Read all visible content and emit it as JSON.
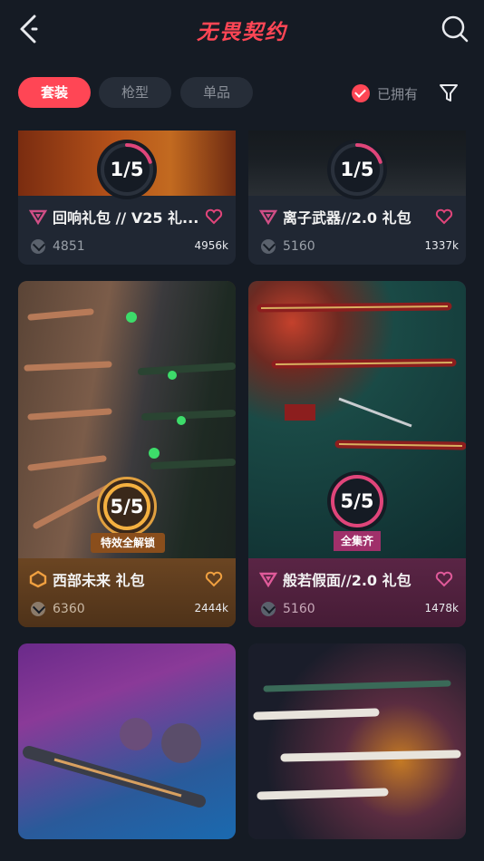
{
  "header": {
    "title": "无畏契约"
  },
  "tabs": [
    {
      "label": "套装",
      "active": true
    },
    {
      "label": "枪型",
      "active": false
    },
    {
      "label": "单品",
      "active": false
    }
  ],
  "owned_filter": {
    "label": "已拥有",
    "checked": true
  },
  "colors": {
    "accent": "#ff4655",
    "background": "#151b24",
    "card": "#202733"
  },
  "cards": [
    {
      "name": "回响礼包 // V25 礼...",
      "price": "4851",
      "likes": "4956k",
      "progress_text": "1/5",
      "progress": 0.2
    },
    {
      "name": "离子武器//2.0 礼包",
      "price": "5160",
      "likes": "1337k",
      "progress_text": "1/5",
      "progress": 0.2
    },
    {
      "name": "西部未来 礼包",
      "price": "6360",
      "likes": "2444k",
      "progress_text": "5/5",
      "progress": 1.0,
      "banner": "特效全解锁"
    },
    {
      "name": "般若假面//2.0 礼包",
      "price": "5160",
      "likes": "1478k",
      "progress_text": "5/5",
      "progress": 1.0,
      "banner": "全集齐"
    }
  ]
}
